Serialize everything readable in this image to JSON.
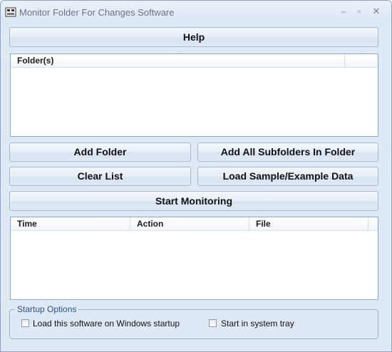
{
  "window": {
    "title": "Monitor Folder For Changes Software",
    "controls": {
      "minimize": "–",
      "maximize": "▫",
      "close": "✕"
    }
  },
  "buttons": {
    "help": "Help",
    "add_folder": "Add Folder",
    "add_all_subfolders": "Add All Subfolders In Folder",
    "clear_list": "Clear List",
    "load_sample": "Load Sample/Example Data",
    "start_monitoring": "Start Monitoring"
  },
  "folders_list": {
    "columns": [
      "Folder(s)"
    ],
    "rows": []
  },
  "events_list": {
    "columns": [
      "Time",
      "Action",
      "File"
    ],
    "rows": []
  },
  "startup_options": {
    "label": "Startup Options",
    "load_on_startup": {
      "label": "Load this software on Windows startup",
      "checked": false
    },
    "start_in_tray": {
      "label": "Start in system tray",
      "checked": false
    }
  },
  "colors": {
    "window_bg": "#dfe9f5",
    "group_label": "#2c4f8c",
    "border": "#8fa6c6"
  }
}
